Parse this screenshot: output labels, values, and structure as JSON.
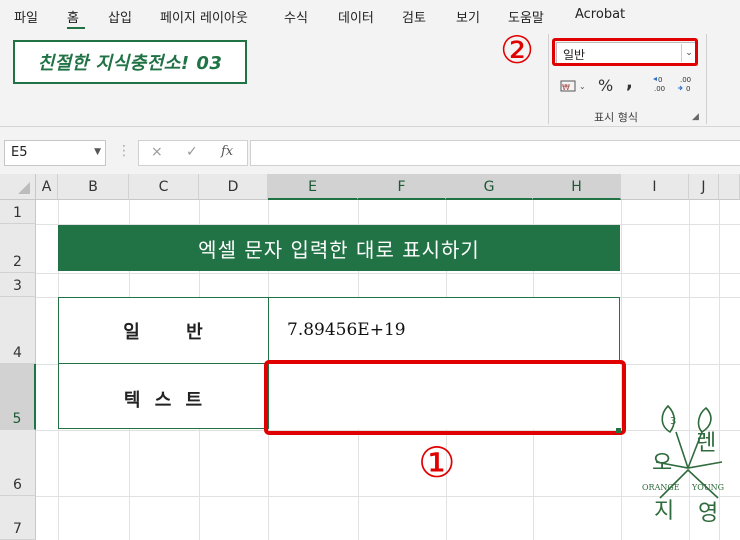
{
  "menu": {
    "items": [
      "파일",
      "홈",
      "삽입",
      "페이지 레이아웃",
      "수식",
      "데이터",
      "검토",
      "보기",
      "도움말",
      "Acrobat"
    ],
    "active_index": 1
  },
  "ribbon": {
    "banner_text": "친절한 지식충전소! 03",
    "number_format_value": "일반",
    "number_format_dropdown_icon": "chevron-down-icon",
    "tools": {
      "accounting": "accounting-format-icon",
      "percent": "%",
      "comma": ",",
      "increase_decimal": "increase-decimal-icon",
      "decrease_decimal": "decrease-decimal-icon"
    },
    "group_label": "표시 형식"
  },
  "annotations": {
    "marker_1": "①",
    "marker_2": "②",
    "highlight_color": "#e00000"
  },
  "formula_bar": {
    "name_box": "E5",
    "cancel_icon": "×",
    "confirm_icon": "✓",
    "fx_label": "fx",
    "formula_value": ""
  },
  "grid": {
    "columns": [
      "A",
      "B",
      "C",
      "D",
      "E",
      "F",
      "G",
      "H",
      "I",
      "J"
    ],
    "rows": [
      "1",
      "2",
      "3",
      "4",
      "5",
      "6",
      "7"
    ],
    "selected_column": "E",
    "selected_row": "5"
  },
  "sheet": {
    "title": "엑셀 문자 입력한 대로 표시하기",
    "row1_label": "일 반",
    "row1_value": "7.89456E+19",
    "row2_label": "텍 스 트",
    "row2_value": ""
  },
  "logo": {
    "chars": [
      "오",
      "렌",
      "지",
      "영"
    ],
    "left_text": "ORANGE",
    "right_text": "YOUNG"
  },
  "colors": {
    "accent": "#217346",
    "red": "#e00000"
  }
}
